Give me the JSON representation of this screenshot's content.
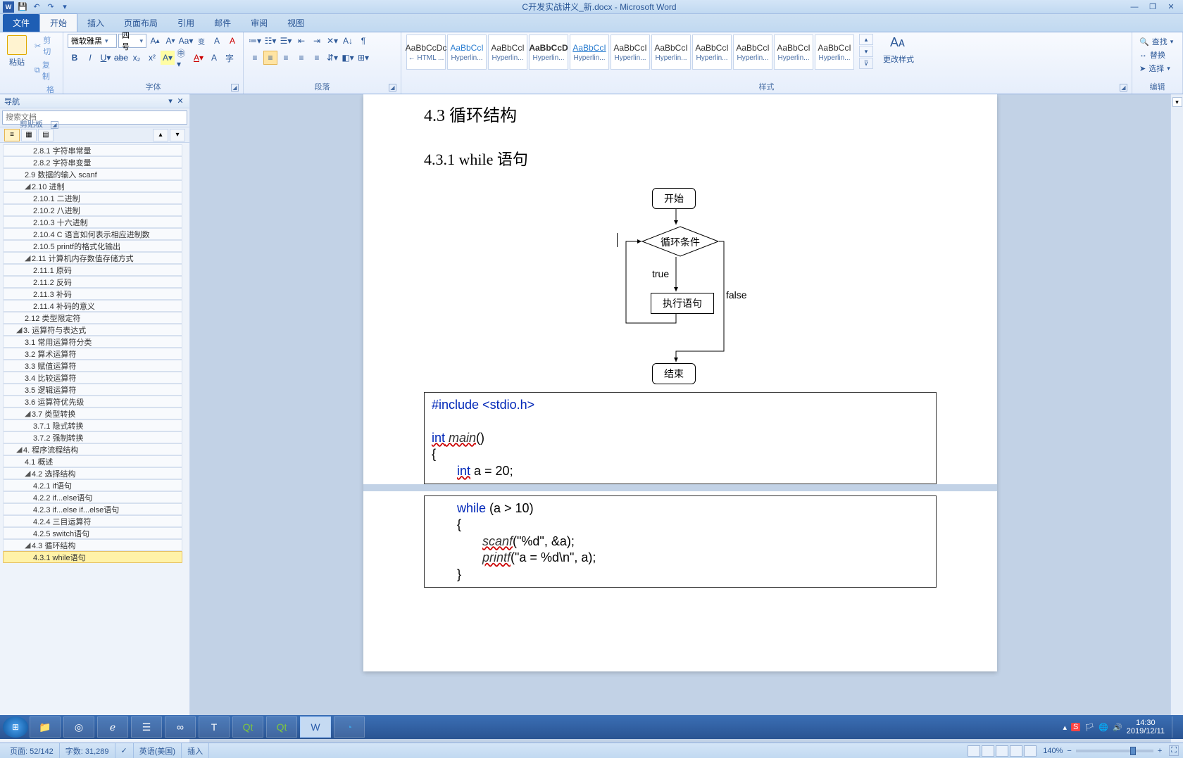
{
  "titlebar": {
    "title": "C开发实战讲义_新.docx - Microsoft Word"
  },
  "tabs": {
    "file": "文件",
    "home": "开始",
    "insert": "插入",
    "layout": "页面布局",
    "ref": "引用",
    "mail": "邮件",
    "review": "审阅",
    "view": "视图"
  },
  "clipboard": {
    "paste": "粘贴",
    "cut": "剪切",
    "copy": "复制",
    "fmt": "格式刷",
    "label": "剪贴板"
  },
  "font": {
    "family": "微软雅黑",
    "size": "四号",
    "label": "字体"
  },
  "para": {
    "label": "段落"
  },
  "styles_group": {
    "label": "样式",
    "change": "更改样式"
  },
  "styles": [
    {
      "preview": "AaBbCcDc",
      "name": "← HTML ..."
    },
    {
      "preview": "AaBbCcI",
      "name": "Hyperlin...",
      "link": true
    },
    {
      "preview": "AaBbCcI",
      "name": "Hyperlin..."
    },
    {
      "preview": "AaBbCcD",
      "name": "Hyperlin...",
      "bold": true
    },
    {
      "preview": "AaBbCcI",
      "name": "Hyperlin...",
      "link": true,
      "ul": true
    },
    {
      "preview": "AaBbCcI",
      "name": "Hyperlin..."
    },
    {
      "preview": "AaBbCcI",
      "name": "Hyperlin..."
    },
    {
      "preview": "AaBbCcI",
      "name": "Hyperlin..."
    },
    {
      "preview": "AaBbCcI",
      "name": "Hyperlin..."
    },
    {
      "preview": "AaBbCcI",
      "name": "Hyperlin..."
    },
    {
      "preview": "AaBbCcI",
      "name": "Hyperlin..."
    }
  ],
  "edit": {
    "find": "查找",
    "replace": "替换",
    "select": "选择",
    "label": "编辑"
  },
  "nav": {
    "title": "导航",
    "search_placeholder": "搜索文档",
    "tree": [
      {
        "lvl": 3,
        "label": "2.8.1 字符串常量"
      },
      {
        "lvl": 3,
        "label": "2.8.2 字符串变量"
      },
      {
        "lvl": 2,
        "label": "2.9 数据的输入 scanf"
      },
      {
        "lvl": 2,
        "label": "2.10 进制",
        "exp": true
      },
      {
        "lvl": 3,
        "label": "2.10.1 二进制"
      },
      {
        "lvl": 3,
        "label": "2.10.2 八进制"
      },
      {
        "lvl": 3,
        "label": "2.10.3 十六进制"
      },
      {
        "lvl": 3,
        "label": "2.10.4 C 语言如何表示相应进制数"
      },
      {
        "lvl": 3,
        "label": "2.10.5 printf的格式化输出"
      },
      {
        "lvl": 2,
        "label": "2.11 计算机内存数值存储方式",
        "exp": true
      },
      {
        "lvl": 3,
        "label": "2.11.1 原码"
      },
      {
        "lvl": 3,
        "label": "2.11.2 反码"
      },
      {
        "lvl": 3,
        "label": "2.11.3 补码"
      },
      {
        "lvl": 3,
        "label": "2.11.4 补码的意义"
      },
      {
        "lvl": 2,
        "label": "2.12 类型限定符"
      },
      {
        "lvl": 1,
        "label": "3. 运算符与表达式",
        "exp": true
      },
      {
        "lvl": 2,
        "label": "3.1 常用运算符分类"
      },
      {
        "lvl": 2,
        "label": "3.2 算术运算符"
      },
      {
        "lvl": 2,
        "label": "3.3 赋值运算符"
      },
      {
        "lvl": 2,
        "label": "3.4 比较运算符"
      },
      {
        "lvl": 2,
        "label": "3.5 逻辑运算符"
      },
      {
        "lvl": 2,
        "label": "3.6 运算符优先级"
      },
      {
        "lvl": 2,
        "label": "3.7 类型转换",
        "exp": true
      },
      {
        "lvl": 3,
        "label": "3.7.1 隐式转换"
      },
      {
        "lvl": 3,
        "label": "3.7.2 强制转换"
      },
      {
        "lvl": 1,
        "label": "4. 程序流程结构",
        "exp": true
      },
      {
        "lvl": 2,
        "label": "4.1 概述"
      },
      {
        "lvl": 2,
        "label": "4.2 选择结构",
        "exp": true
      },
      {
        "lvl": 3,
        "label": "4.2.1 if语句"
      },
      {
        "lvl": 3,
        "label": "4.2.2 if...else语句"
      },
      {
        "lvl": 3,
        "label": "4.2.3 if...else if...else语句"
      },
      {
        "lvl": 3,
        "label": "4.2.4 三目运算符"
      },
      {
        "lvl": 3,
        "label": "4.2.5 switch语句"
      },
      {
        "lvl": 2,
        "label": "4.3 循环结构",
        "exp": true
      },
      {
        "lvl": 3,
        "label": "4.3.1 while语句",
        "active": true
      }
    ]
  },
  "doc": {
    "h1": "4.3 循环结构",
    "h2": "4.3.1 while 语句",
    "flow": {
      "start": "开始",
      "cond": "循环条件",
      "true": "true",
      "exec": "执行语句",
      "false": "false",
      "end": "结束"
    },
    "code1_include": "#include <stdio.h>",
    "code1_int": "int",
    "code1_main": " main",
    "code1_paren": "()",
    "code1_brace": "{",
    "code1_decl_kw": "int",
    "code1_decl_rest": " a = 20;",
    "code2_while_kw": "while",
    "code2_while_cond": " (a > 10)",
    "code2_brace_o": "{",
    "code2_scanf": "scanf",
    "code2_scanf_args": "(\"%d\", &a);",
    "code2_printf": "printf",
    "code2_printf_args": "(\"a = %d\\n\", a);",
    "code2_brace_c": "}"
  },
  "status": {
    "page": "页面: 52/142",
    "words": "字数: 31,289",
    "lang": "英语(美国)",
    "ins": "插入",
    "zoom": "140%"
  },
  "tray": {
    "time": "14:30",
    "date": "2019/12/11"
  }
}
